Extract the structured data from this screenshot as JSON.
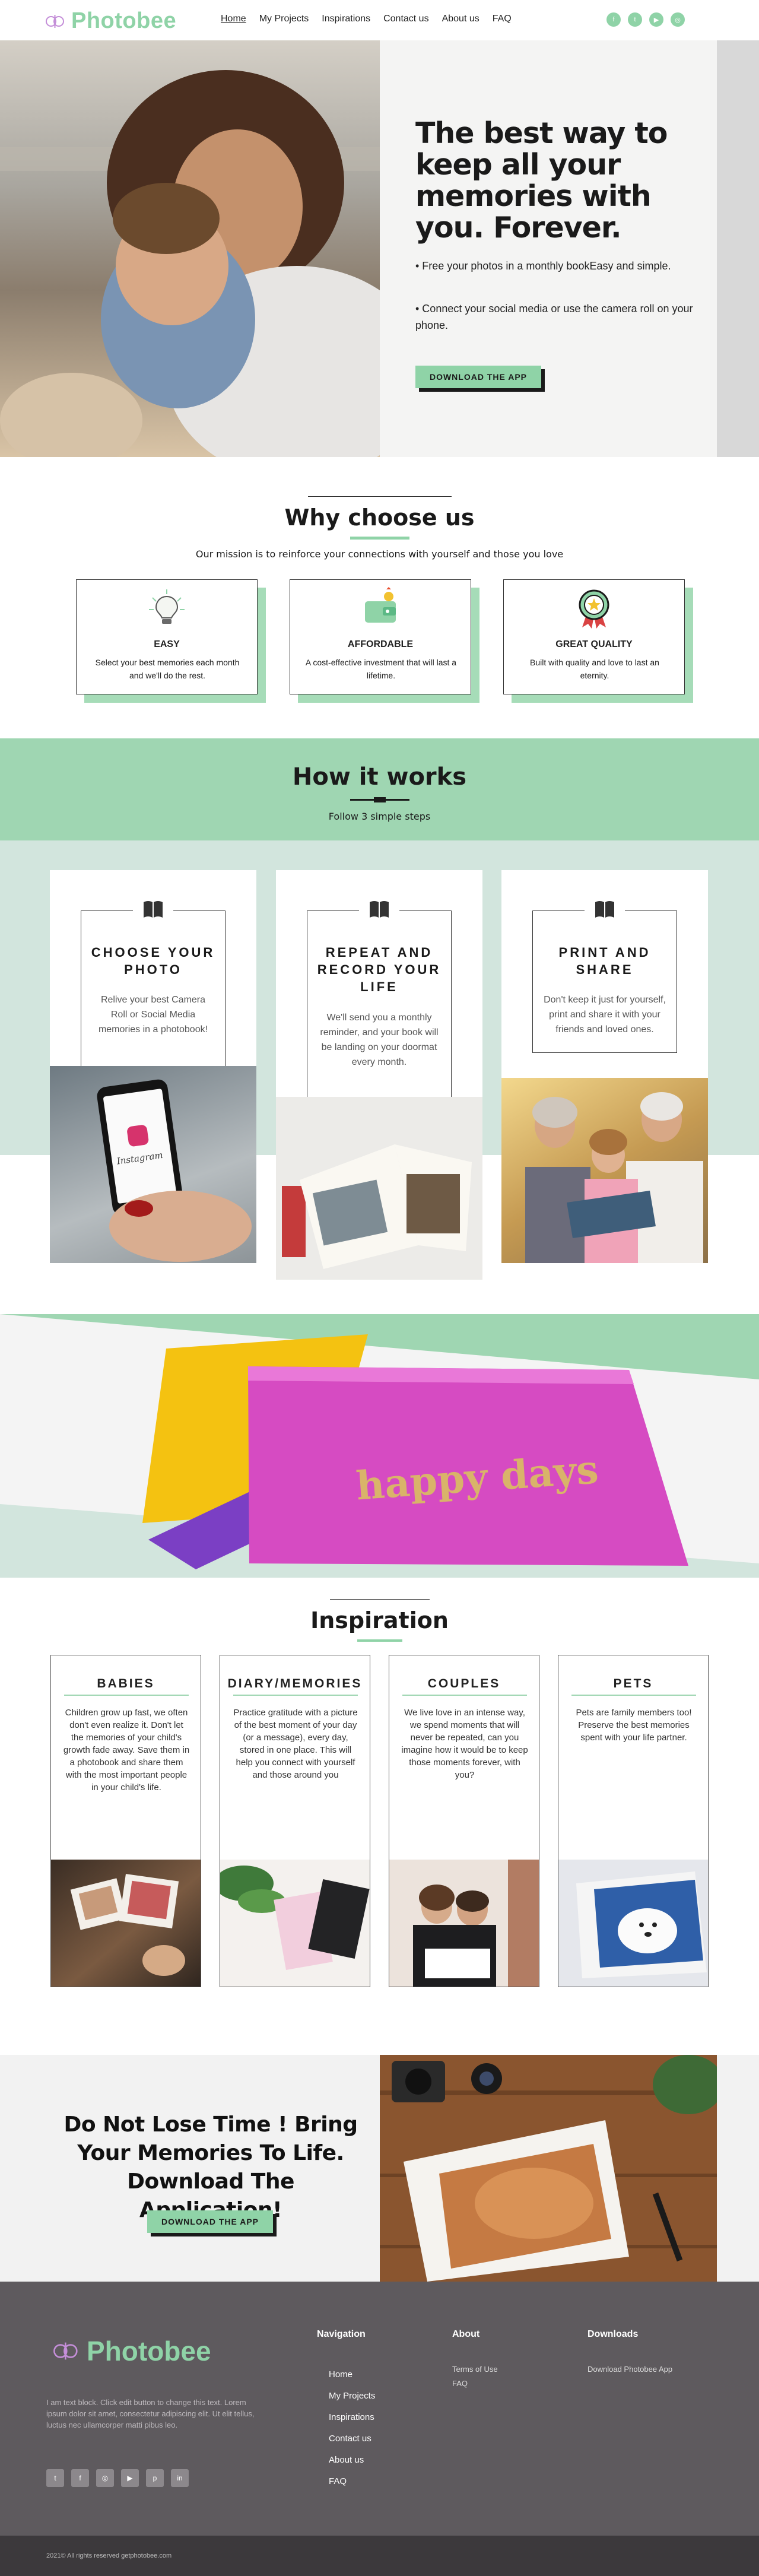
{
  "brand": {
    "name": "Photobee",
    "accent": "#8fd3a7",
    "dark": "#1a1a1a"
  },
  "nav": {
    "items": [
      "Home",
      "My Projects",
      "Inspirations",
      "Contact us",
      "About us",
      "FAQ"
    ],
    "active": "Home"
  },
  "social_top": [
    "facebook-icon",
    "twitter-icon",
    "youtube-icon",
    "instagram-icon"
  ],
  "hero": {
    "title": "The best way to keep all your memories with you. Forever.",
    "bullet1": "• Free your photos in a monthly bookEasy and simple.",
    "bullet2": "• Connect your social media or use the camera roll on your phone.",
    "cta": "DOWNLOAD THE APP"
  },
  "why": {
    "title": "Why choose us",
    "mission": "Our mission is to reinforce your connections with yourself and those you love",
    "cards": [
      {
        "icon": "lightbulb-icon",
        "title": "EASY",
        "text": "Select your best memories each month and we'll do the rest."
      },
      {
        "icon": "wallet-icon",
        "title": "AFFORDABLE",
        "text": "A cost-effective investment that will last a lifetime."
      },
      {
        "icon": "award-badge-icon",
        "title": "GREAT QUALITY",
        "text": "Built with quality and love to last an eternity."
      }
    ]
  },
  "how": {
    "title": "How it works",
    "subtitle": "Follow 3 simple steps",
    "steps": [
      {
        "title": "CHOOSE YOUR PHOTO",
        "text": "Relive your best Camera Roll or Social Media memories in a photobook!"
      },
      {
        "title": "REPEAT AND RECORD YOUR LIFE",
        "text": "We'll send you a monthly reminder, and your book will be landing on your doormat every month."
      },
      {
        "title": "PRINT AND SHARE",
        "text": "Don't keep it just for yourself, print and share it with your friends and loved ones."
      }
    ],
    "phone_app_label": "Instagram"
  },
  "banner": {
    "book_text": "happy days"
  },
  "inspiration": {
    "title": "Inspiration",
    "cards": [
      {
        "title": "BABIES",
        "text": "Children grow up fast, we often don't even realize it. Don't let the memories of your child's growth fade away. Save them in a photobook and share them with the most important people in your child's life."
      },
      {
        "title": "DIARY/MEMORIES",
        "text": "Practice gratitude with a picture of the best moment of your day (or a message), every day, stored in one place. This will help you connect with yourself and those around you"
      },
      {
        "title": "COUPLES",
        "text": "We live love in an intense way, we spend moments that will never be repeated, can you imagine how it would be to keep those moments forever, with you?"
      },
      {
        "title": "PETS",
        "text": "Pets are family members too! Preserve the best memories spent with your life partner."
      }
    ]
  },
  "download": {
    "title": "Do Not Lose Time ! Bring Your Memories To Life. Download The Application!",
    "cta": "DOWNLOAD THE APP"
  },
  "footer": {
    "blurb": "I am text block. Click edit button to change this text. Lorem ipsum dolor sit amet, consectetur adipiscing elit. Ut elit tellus, luctus nec ullamcorper matti pibus leo.",
    "social": [
      "twitter-icon",
      "facebook-icon",
      "instagram-icon",
      "youtube-icon",
      "pinterest-icon",
      "linkedin-icon"
    ],
    "navigation": {
      "heading": "Navigation",
      "links": [
        "Home",
        "My Projects",
        "Inspirations",
        "Contact us",
        "About us",
        "FAQ"
      ]
    },
    "about": {
      "heading": "About",
      "links": [
        "Terms of Use",
        "FAQ"
      ]
    },
    "downloads": {
      "heading": "Downloads",
      "links": [
        "Download Photobee App"
      ]
    },
    "copyright": "2021© All rights reserved getphotobee.com"
  }
}
